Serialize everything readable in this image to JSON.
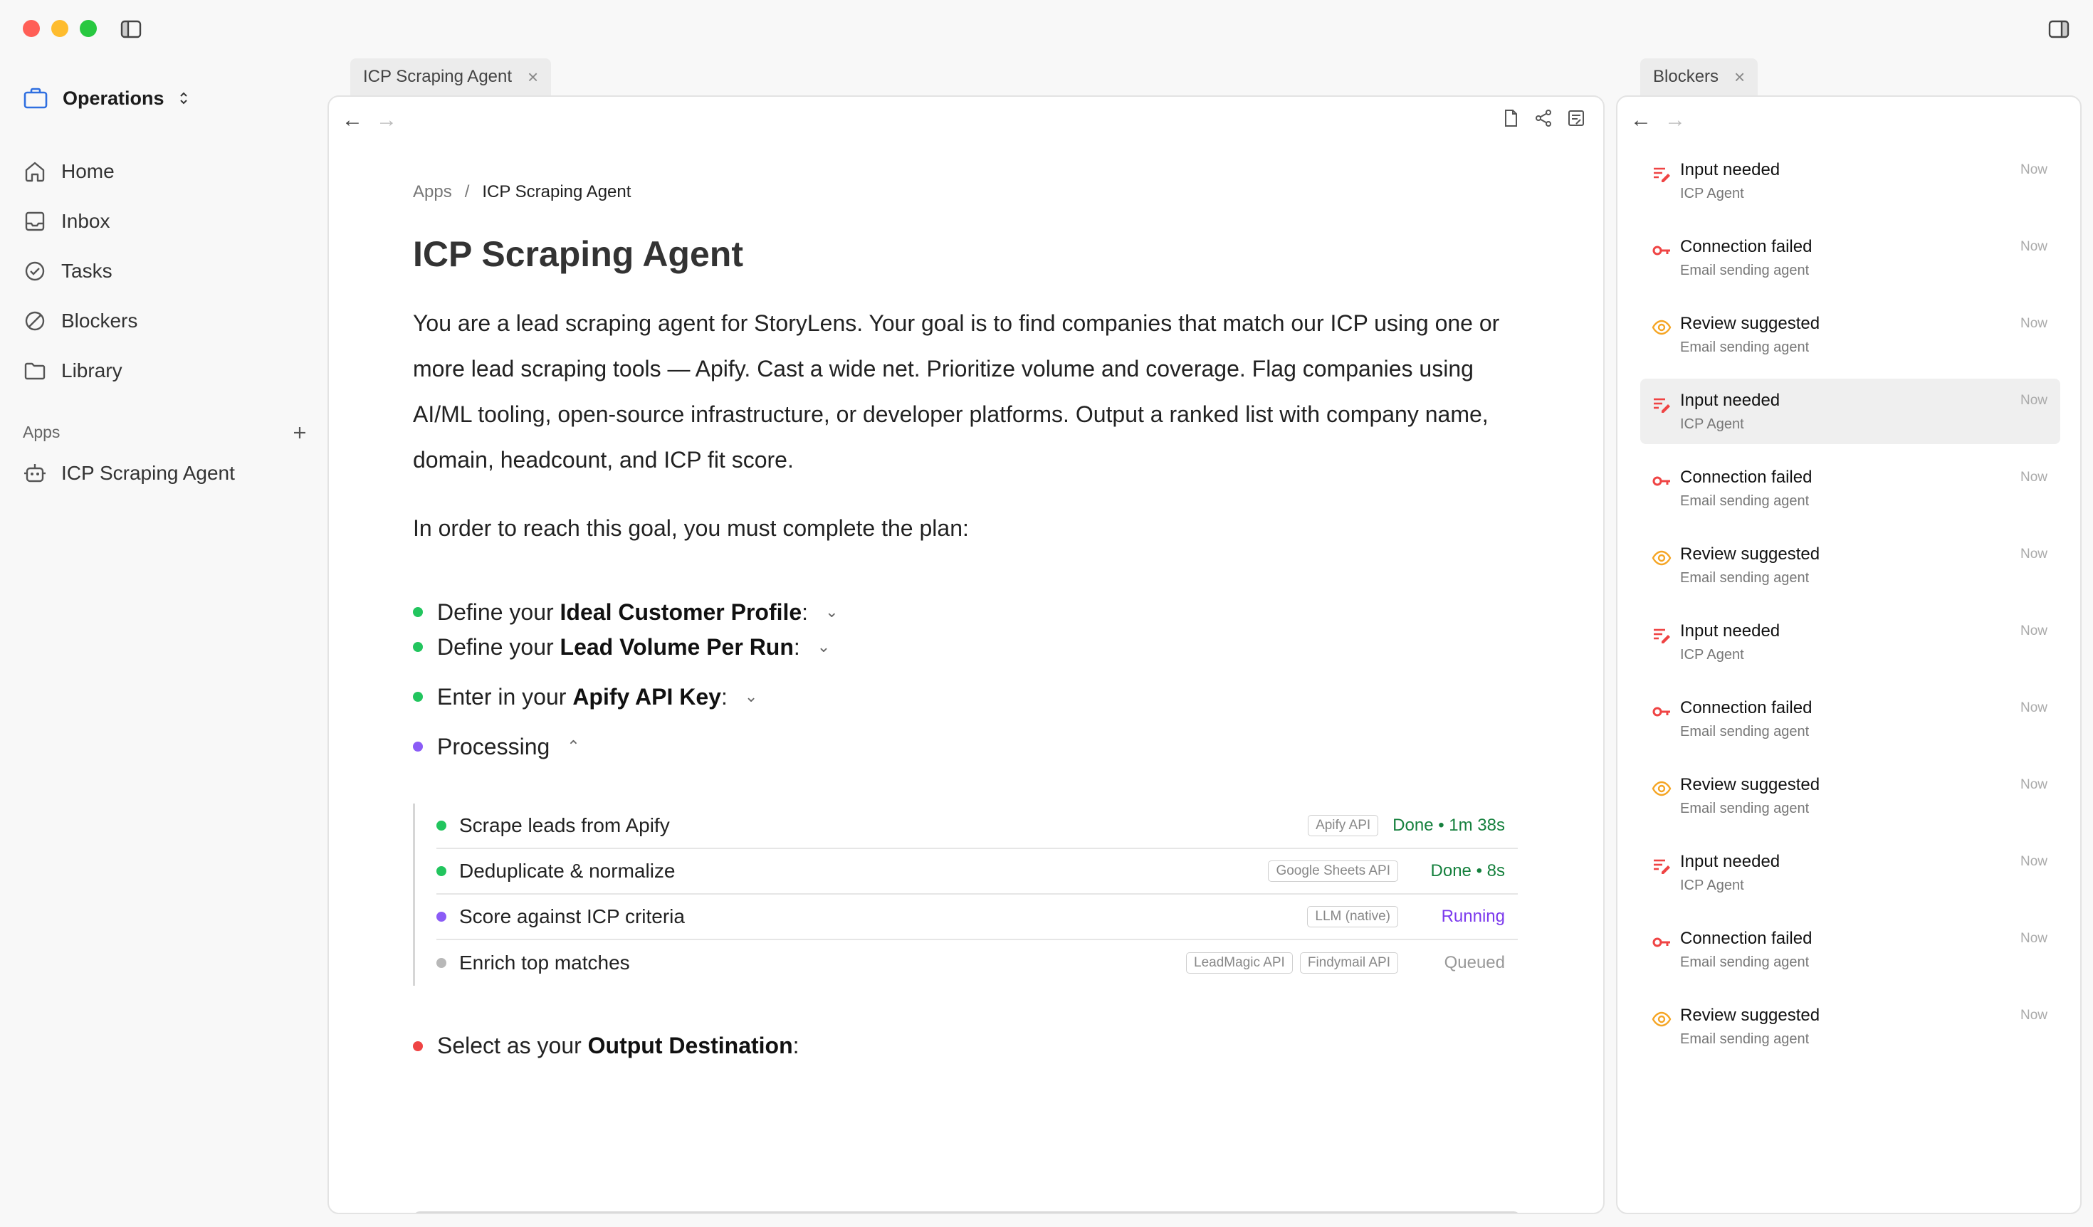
{
  "workspace": {
    "label": "Operations"
  },
  "nav": [
    {
      "label": "Home",
      "icon": "home-icon"
    },
    {
      "label": "Inbox",
      "icon": "inbox-icon"
    },
    {
      "label": "Tasks",
      "icon": "check-circle-icon"
    },
    {
      "label": "Blockers",
      "icon": "slash-circle-icon"
    },
    {
      "label": "Library",
      "icon": "folder-icon"
    }
  ],
  "apps": {
    "label": "Apps",
    "items": [
      {
        "label": "ICP Scraping Agent"
      }
    ]
  },
  "tabs": {
    "main": {
      "label": "ICP Scraping Agent"
    },
    "side": {
      "label": "Blockers"
    }
  },
  "main": {
    "breadcrumb": {
      "root": "Apps",
      "separator": "/",
      "current": "ICP Scraping Agent"
    },
    "title": "ICP Scraping Agent",
    "description": "You are a lead scraping agent for StoryLens. Your goal is to find companies that match our ICP using one or more lead scraping tools — Apify. Cast a wide net. Prioritize volume and coverage. Flag companies using AI/ML tooling, open-source infrastructure, or developer platforms. Output a ranked list with company name, domain, headcount, and ICP fit score.",
    "plan_intro": "In order to reach this goal, you must complete the plan:",
    "plan": [
      {
        "prefix": "Define your ",
        "bold": "Ideal Customer Profile",
        "suffix": ":",
        "chevron": "⌄",
        "color": "#22c55e"
      },
      {
        "prefix": "Define your ",
        "bold": "Lead Volume Per Run",
        "suffix": ":",
        "chevron": "⌄",
        "color": "#22c55e"
      },
      {
        "prefix": "Enter in your ",
        "bold": "Apify API Key",
        "suffix": ":",
        "chevron": "⌄",
        "color": "#22c55e"
      },
      {
        "prefix": "Processing",
        "bold": "",
        "suffix": "",
        "chevron": "⌃",
        "color": "#8b5cf6"
      }
    ],
    "steps": [
      {
        "label": "Scrape leads from Apify",
        "chips": [
          "Apify API"
        ],
        "status": "Done • 1m 38s",
        "state": "done"
      },
      {
        "label": "Deduplicate & normalize",
        "chips": [
          "Google Sheets API"
        ],
        "status": "Done • 8s",
        "state": "done"
      },
      {
        "label": "Score against ICP criteria",
        "chips": [
          "LLM (native)"
        ],
        "status": "Running",
        "state": "running"
      },
      {
        "label": "Enrich top matches",
        "chips": [
          "LeadMagic API",
          "Findymail API"
        ],
        "status": "Queued",
        "state": "queued"
      }
    ],
    "output": {
      "prefix": "Select as your ",
      "bold": "Output Destination",
      "suffix": ":"
    }
  },
  "blockers": [
    {
      "title": "Input needed",
      "source": "ICP Agent",
      "time": "Now",
      "kind": "input"
    },
    {
      "title": "Connection failed",
      "source": "Email sending agent",
      "time": "Now",
      "kind": "connection"
    },
    {
      "title": "Review suggested",
      "source": "Email sending agent",
      "time": "Now",
      "kind": "review"
    },
    {
      "title": "Input needed",
      "source": "ICP Agent",
      "time": "Now",
      "kind": "input",
      "highlight": true
    },
    {
      "title": "Connection failed",
      "source": "Email sending agent",
      "time": "Now",
      "kind": "connection"
    },
    {
      "title": "Review suggested",
      "source": "Email sending agent",
      "time": "Now",
      "kind": "review"
    },
    {
      "title": "Input needed",
      "source": "ICP Agent",
      "time": "Now",
      "kind": "input"
    },
    {
      "title": "Connection failed",
      "source": "Email sending agent",
      "time": "Now",
      "kind": "connection"
    },
    {
      "title": "Review suggested",
      "source": "Email sending agent",
      "time": "Now",
      "kind": "review"
    },
    {
      "title": "Input needed",
      "source": "ICP Agent",
      "time": "Now",
      "kind": "input"
    },
    {
      "title": "Connection failed",
      "source": "Email sending agent",
      "time": "Now",
      "kind": "connection"
    },
    {
      "title": "Review suggested",
      "source": "Email sending agent",
      "time": "Now",
      "kind": "review"
    }
  ],
  "colors": {
    "done": "#22c55e",
    "running": "#8b5cf6",
    "queued": "#b8b8b8",
    "error": "#ef4444",
    "warning": "#f5a524",
    "accent": "#2f6fe0"
  }
}
